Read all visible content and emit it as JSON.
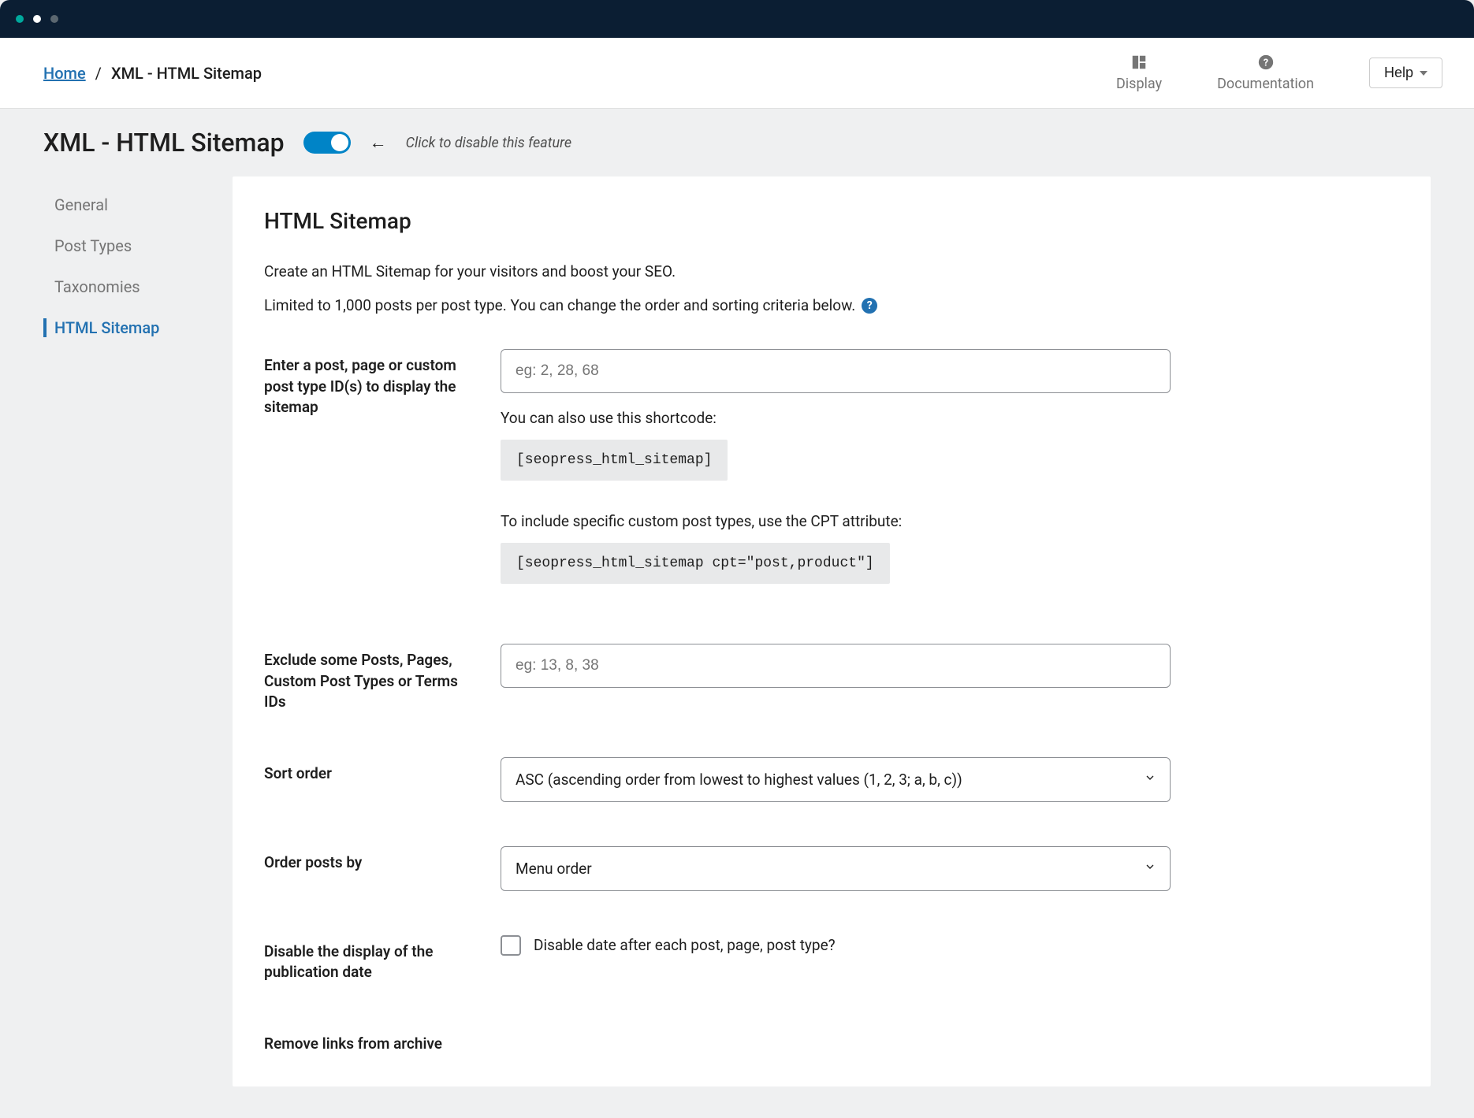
{
  "breadcrumb": {
    "home": "Home",
    "sep": "/",
    "current": "XML - HTML Sitemap"
  },
  "topbar": {
    "display": "Display",
    "documentation": "Documentation",
    "help": "Help"
  },
  "header": {
    "title": "XML - HTML Sitemap",
    "toggle_hint": "Click to disable this feature"
  },
  "sidebar": {
    "items": [
      {
        "label": "General"
      },
      {
        "label": "Post Types"
      },
      {
        "label": "Taxonomies"
      },
      {
        "label": "HTML Sitemap"
      }
    ]
  },
  "panel": {
    "title": "HTML Sitemap",
    "intro1": "Create an HTML Sitemap for your visitors and boost your SEO.",
    "intro2": "Limited to 1,000 posts per post type. You can change the order and sorting criteria below.",
    "fields": {
      "include": {
        "label": "Enter a post, page or custom post type ID(s) to display the sitemap",
        "placeholder": "eg: 2, 28, 68",
        "hint1": "You can also use this shortcode:",
        "code1": "[seopress_html_sitemap]",
        "hint2": "To include specific custom post types, use the CPT attribute:",
        "code2": "[seopress_html_sitemap cpt=\"post,product\"]"
      },
      "exclude": {
        "label": "Exclude some Posts, Pages, Custom Post Types or Terms IDs",
        "placeholder": "eg: 13, 8, 38"
      },
      "sort_order": {
        "label": "Sort order",
        "value": "ASC (ascending order from lowest to highest values (1, 2, 3; a, b, c))"
      },
      "order_by": {
        "label": "Order posts by",
        "value": "Menu order"
      },
      "disable_date": {
        "label": "Disable the display of the publication date",
        "checkbox_label": "Disable date after each post, page, post type?"
      },
      "remove_links": {
        "label": "Remove links from archive"
      }
    }
  }
}
